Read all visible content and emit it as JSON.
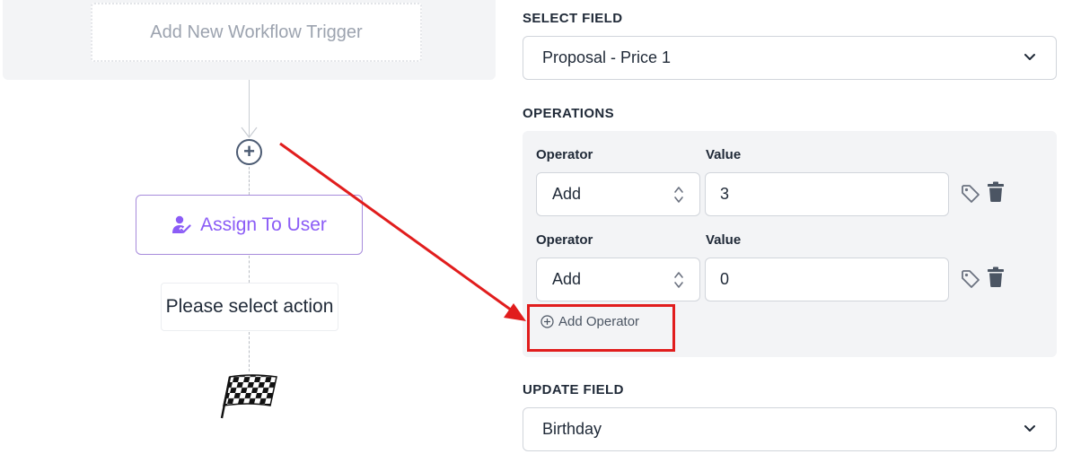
{
  "canvas": {
    "add_trigger_label": "Add New Workflow Trigger",
    "add_step_symbol": "+",
    "assign_node_label": "Assign To User",
    "select_action_label": "Please select action"
  },
  "panel": {
    "select_field": {
      "label": "SELECT FIELD",
      "value": "Proposal - Price 1"
    },
    "operations": {
      "label": "OPERATIONS",
      "rows": [
        {
          "operator_label": "Operator",
          "value_label": "Value",
          "operator": "Add",
          "value": "3"
        },
        {
          "operator_label": "Operator",
          "value_label": "Value",
          "operator": "Add",
          "value": "0"
        }
      ],
      "add_operator_label": "Add Operator"
    },
    "update_field": {
      "label": "UPDATE FIELD",
      "value": "Birthday"
    }
  },
  "colors": {
    "accent_purple": "#8b5cf6",
    "annotation_red": "#e11d1d",
    "panel_gray": "#f3f4f6"
  }
}
